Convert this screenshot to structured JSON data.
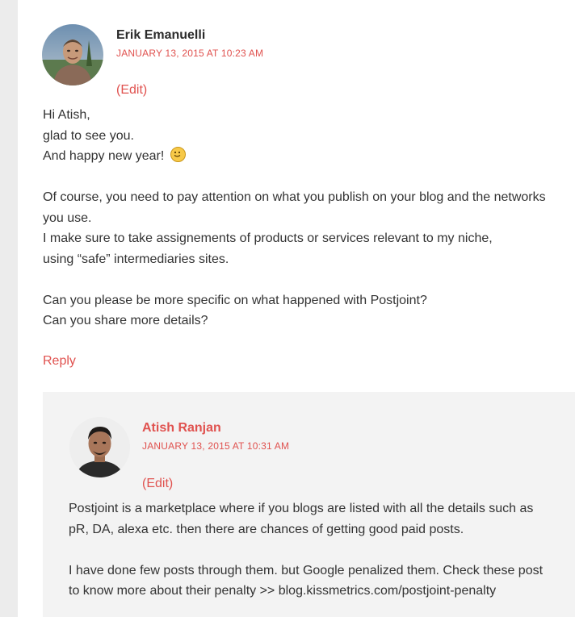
{
  "comment1": {
    "author": "Erik Emanuelli",
    "date": "JANUARY 13, 2015 AT 10:23 AM",
    "edit_label": "(Edit)",
    "lines": [
      "Hi Atish,",
      "glad to see you.",
      "And happy new year!"
    ],
    "emoji": "slightly-smiling-face-icon",
    "para2": [
      "Of course, you need to pay attention on what you publish on your blog and the networks",
      "you use.",
      "I make sure to take assignements of products or services relevant to my niche,",
      "using “safe” intermediaries sites."
    ],
    "para3": [
      "Can you please be more specific on what happened with Postjoint?",
      "Can you share more details?"
    ],
    "reply_label": "Reply"
  },
  "comment2": {
    "author": "Atish Ranjan",
    "date": "JANUARY 13, 2015 AT 10:31 AM",
    "edit_label": "(Edit)",
    "para1": [
      "Postjoint is a marketplace where if you blogs are listed with all the details such as",
      "pR, DA, alexa etc. then there are chances of getting good paid posts."
    ],
    "para2": [
      "I have done few posts through them. but Google penalized them. Check these post",
      "to know more about their penalty >> blog.kissmetrics.com/postjoint-penalty"
    ]
  },
  "colors": {
    "accent": "#e0524f",
    "text": "#333333",
    "nested_bg": "#f3f3f3",
    "page_bg": "#ececec"
  }
}
